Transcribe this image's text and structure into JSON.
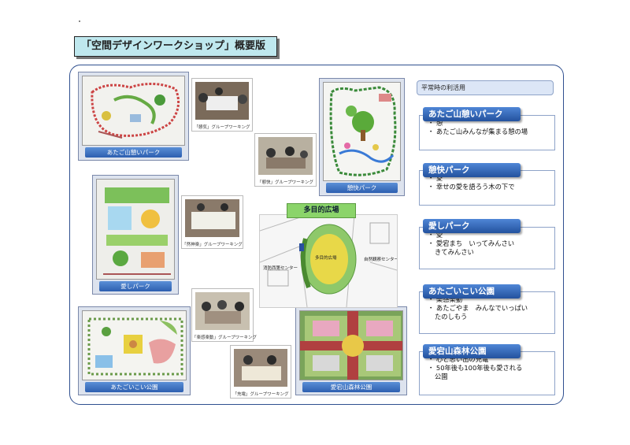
{
  "title": "「空間デザインワークショップ」概要版",
  "plans": [
    {
      "label": "あたご山憩いパーク"
    },
    {
      "label": "憩快パーク"
    },
    {
      "label": "愛しパーク"
    },
    {
      "label": "あたごいこい公園"
    },
    {
      "label": "愛宕山森林公園"
    }
  ],
  "snapshots": [
    {
      "caption": "「憩気」グループワーキング"
    },
    {
      "caption": "「憩快」グループワーキング"
    },
    {
      "caption": "「然神楽」グループワーキング"
    },
    {
      "caption": "「楽感楽動」グループワーキング"
    },
    {
      "caption": "「充電」グループワーキング"
    }
  ],
  "map": {
    "label": "多目的広場",
    "places": {
      "center": "多目的広場",
      "left": "消防西第センター",
      "right": "自然観察センター"
    }
  },
  "sidebar": {
    "header": "平常時の利活用",
    "items": [
      {
        "title": "あたご山憩いパーク",
        "bullets": [
          "・ 憩",
          "・ あたご山みんなが集まる憩の場"
        ]
      },
      {
        "title": "憩快パーク",
        "bullets": [
          "・ 愛",
          "・ 幸せの愛を語ろう木の下で"
        ]
      },
      {
        "title": "愛しパーク",
        "bullets": [
          "・ 愛",
          "・ 愛宕まち　いってみんさい",
          "きてみんさい"
        ]
      },
      {
        "title": "あたごいこい公園",
        "bullets": [
          "・ 楽感楽動",
          "・ あたごやま　みんなでいっぱい",
          "たのしもう"
        ]
      },
      {
        "title": "愛宕山森林公園",
        "bullets": [
          "・ 心と思い出の充電",
          "・ 50年後も100年後も愛される",
          "公園"
        ]
      }
    ]
  },
  "colors": {
    "title_bg": "#bfe8ee",
    "frame": "#2f4f8f",
    "label_bar": "#2d5fb0",
    "map_label": "#8bd46a"
  }
}
